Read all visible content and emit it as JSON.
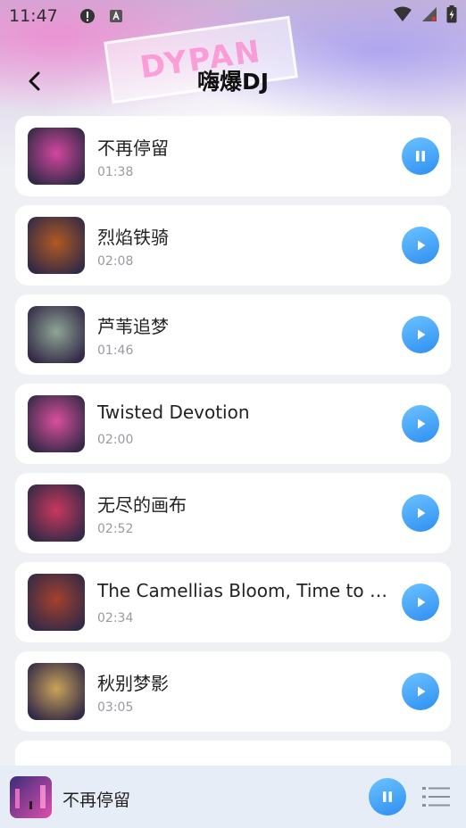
{
  "status_bar": {
    "time": "11:47"
  },
  "hero": {
    "sign_text": "DYPAN"
  },
  "header": {
    "title": "嗨爆DJ"
  },
  "songs": [
    {
      "title": "不再停留",
      "duration": "01:38",
      "state": "pause",
      "thumb": "#d1479f"
    },
    {
      "title": "烈焰铁骑",
      "duration": "02:08",
      "state": "play",
      "thumb": "#b05a22"
    },
    {
      "title": "芦苇追梦",
      "duration": "01:46",
      "state": "play",
      "thumb": "#8fa596"
    },
    {
      "title": "Twisted Devotion",
      "duration": "02:00",
      "state": "play",
      "thumb": "#d94f9c"
    },
    {
      "title": "无尽的画布",
      "duration": "02:52",
      "state": "play",
      "thumb": "#c9385f"
    },
    {
      "title": "The Camellias Bloom, Time to Go...",
      "duration": "02:34",
      "state": "play",
      "thumb": "#a3412e"
    },
    {
      "title": "秋别梦影",
      "duration": "03:05",
      "state": "play",
      "thumb": "#c9a35a"
    }
  ],
  "player": {
    "title": "不再停留",
    "state": "pause"
  },
  "colors": {
    "accent": "#2e8ff2",
    "card": "#ffffff",
    "background": "#eef0f4"
  }
}
